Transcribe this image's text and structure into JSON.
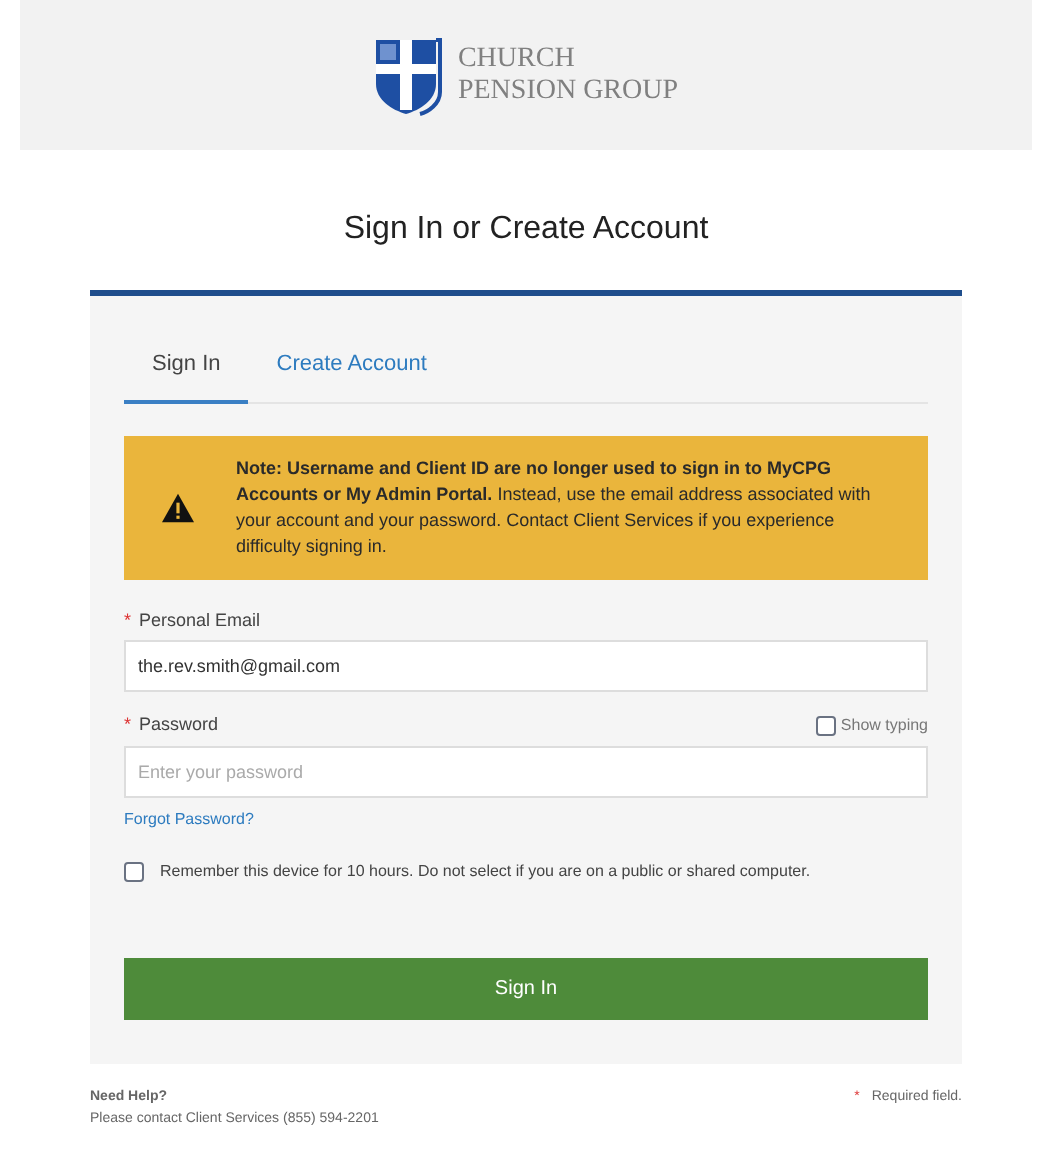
{
  "header": {
    "logo_lines": [
      "CHURCH",
      "PENSION GROUP"
    ]
  },
  "title": "Sign In or Create Account",
  "tabs": [
    {
      "label": "Sign In",
      "selected": true
    },
    {
      "label": "Create Account",
      "selected": false
    }
  ],
  "notice": "**Note: Username and Client ID are no longer used to sign in to MyCPG Accounts or My Admin Portal.** Instead, use the email address associated with your account and your password. Contact Client Services if you experience difficulty signing in.",
  "email": {
    "mark": "*",
    "label": "Personal Email",
    "value": "the.rev.smith@gmail.com"
  },
  "password": {
    "mark": "*",
    "label": "Password",
    "placeholder": "Enter your password",
    "show_typing": {
      "label": "Show typing",
      "checked": false
    }
  },
  "forgot_link": "Forgot Password?",
  "remember": {
    "label": "Remember this device for 10 hours. Do not select if you are on a public or shared computer.",
    "checked": false
  },
  "submit": "Sign In",
  "help": {
    "title": "Need Help?",
    "text": "Please contact Client Services (855) 594-2201"
  },
  "required_note": {
    "mark": "*",
    "text": "Required field."
  }
}
